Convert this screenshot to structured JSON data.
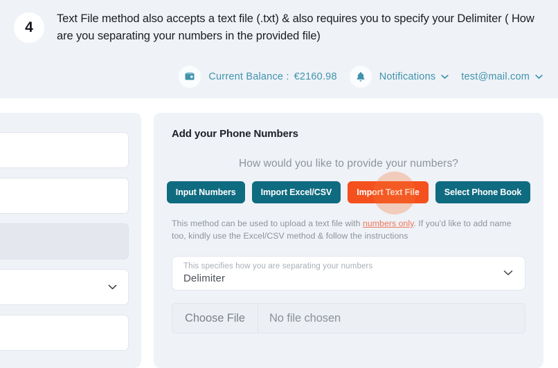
{
  "step": {
    "number": "4",
    "text": "Text File method also accepts a text file (.txt) & also requires you to specify your Delimiter ( How are you separating your numbers in the provided file)"
  },
  "topbar": {
    "wallet_icon": "wallet-icon",
    "balance_label": "Current Balance :",
    "balance_value": "€2160.98",
    "bell_icon": "bell-icon",
    "notifications_label": "Notifications",
    "account_label": "test@mail.com"
  },
  "card": {
    "title": "Add your Phone Numbers",
    "question": "How would you like to provide your numbers?",
    "options": [
      {
        "label": "Input Numbers",
        "active": false
      },
      {
        "label": "Import Excel/CSV",
        "active": false
      },
      {
        "label": "Import Text File",
        "active": true
      },
      {
        "label": "Select Phone Book",
        "active": false
      }
    ],
    "helper_prefix": "This method can be used to upload a text file with ",
    "helper_link": "numbers only",
    "helper_suffix": ". If you'd like to add name too, kindly use the Excel/CSV method & follow the instructions",
    "select": {
      "hint": "This specifies how you are separating your numbers",
      "value": "Delimiter"
    },
    "file": {
      "button_label": "Choose File",
      "status": "No file chosen"
    },
    "cut_text": ""
  },
  "colors": {
    "page_bg": "#ffffff",
    "panel_bg": "#eff2f7",
    "teal": "#0f6b80",
    "orange": "#f4511e",
    "link": "#ef7358",
    "header_text": "#3f93ad"
  }
}
